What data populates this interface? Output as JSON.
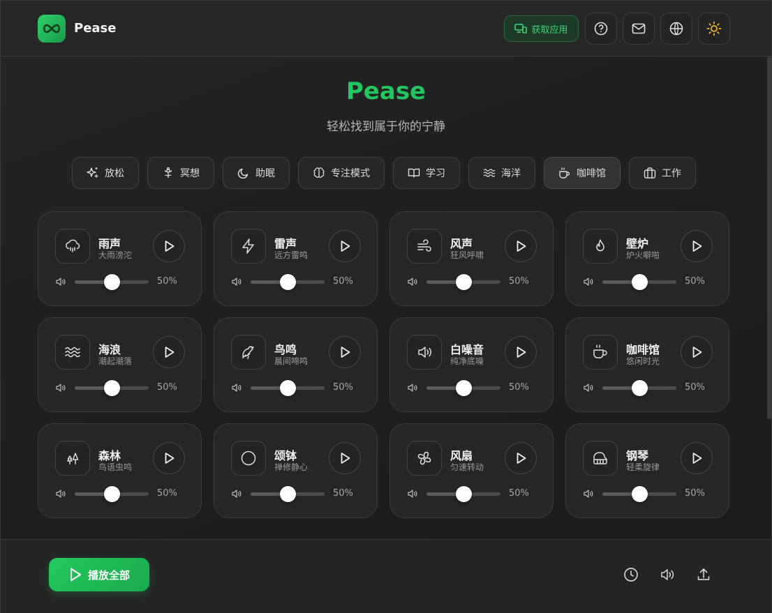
{
  "header": {
    "brand": "Pease",
    "get_app_label": "获取应用",
    "accent": "#22c55e"
  },
  "hero": {
    "title": "Pease",
    "subtitle": "轻松找到属于你的宁静"
  },
  "categories": [
    {
      "label": "放松",
      "icon": "sparkles-icon"
    },
    {
      "label": "冥想",
      "icon": "flower-icon"
    },
    {
      "label": "助眠",
      "icon": "moon-icon"
    },
    {
      "label": "专注模式",
      "icon": "brain-icon"
    },
    {
      "label": "学习",
      "icon": "book-icon"
    },
    {
      "label": "海洋",
      "icon": "waves-icon"
    },
    {
      "label": "咖啡馆",
      "icon": "coffee-icon",
      "active": true
    },
    {
      "label": "工作",
      "icon": "briefcase-icon"
    }
  ],
  "sounds": [
    {
      "name": "雨声",
      "desc": "大雨滂沱",
      "icon": "cloud-rain-icon",
      "volume": 50,
      "volume_label": "50%"
    },
    {
      "name": "雷声",
      "desc": "远方雷鸣",
      "icon": "zap-icon",
      "volume": 50,
      "volume_label": "50%"
    },
    {
      "name": "风声",
      "desc": "狂风呼啸",
      "icon": "wind-icon",
      "volume": 50,
      "volume_label": "50%"
    },
    {
      "name": "壁炉",
      "desc": "炉火噼啪",
      "icon": "flame-icon",
      "volume": 50,
      "volume_label": "50%"
    },
    {
      "name": "海浪",
      "desc": "潮起潮落",
      "icon": "waves-icon",
      "volume": 50,
      "volume_label": "50%"
    },
    {
      "name": "鸟鸣",
      "desc": "晨间啼鸣",
      "icon": "bird-icon",
      "volume": 50,
      "volume_label": "50%"
    },
    {
      "name": "白噪音",
      "desc": "纯净底噪",
      "icon": "speaker-icon",
      "volume": 50,
      "volume_label": "50%"
    },
    {
      "name": "咖啡馆",
      "desc": "悠闲时光",
      "icon": "coffee-icon",
      "volume": 50,
      "volume_label": "50%"
    },
    {
      "name": "森林",
      "desc": "鸟语虫鸣",
      "icon": "trees-icon",
      "volume": 50,
      "volume_label": "50%"
    },
    {
      "name": "颂钵",
      "desc": "禅修静心",
      "icon": "circle-icon",
      "volume": 50,
      "volume_label": "50%"
    },
    {
      "name": "风扇",
      "desc": "匀速转动",
      "icon": "fan-icon",
      "volume": 50,
      "volume_label": "50%"
    },
    {
      "name": "钢琴",
      "desc": "轻柔旋律",
      "icon": "piano-icon",
      "volume": 50,
      "volume_label": "50%"
    }
  ],
  "footer": {
    "play_all_label": "播放全部"
  }
}
